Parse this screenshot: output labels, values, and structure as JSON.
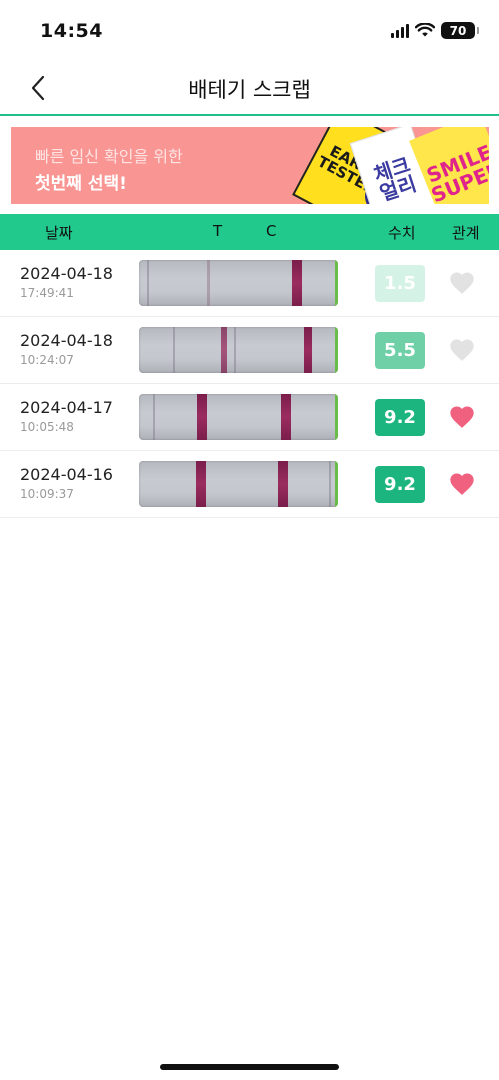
{
  "status_bar": {
    "time": "14:54",
    "battery": "70"
  },
  "nav": {
    "title": "배테기 스크랩"
  },
  "banner": {
    "line1": "빠른 임신 확인을 위한",
    "line2": "첫번째 선택!",
    "products": [
      "EARLY TESTER",
      "체크 얼리",
      "SMILE SUPER"
    ]
  },
  "table": {
    "headers": {
      "date": "날짜",
      "t": "T",
      "c": "C",
      "value": "수치",
      "relation": "관계"
    },
    "rows": [
      {
        "date": "2024-04-18",
        "time": "17:49:41",
        "value": "1.5",
        "value_color": "#d4f2e6",
        "heart": "empty"
      },
      {
        "date": "2024-04-18",
        "time": "10:24:07",
        "value": "5.5",
        "value_color": "#6fd0a8",
        "heart": "empty"
      },
      {
        "date": "2024-04-17",
        "time": "10:05:48",
        "value": "9.2",
        "value_color": "#1db57f",
        "heart": "filled"
      },
      {
        "date": "2024-04-16",
        "time": "10:09:37",
        "value": "9.2",
        "value_color": "#1db57f",
        "heart": "filled"
      }
    ]
  },
  "colors": {
    "accent": "#22c98c",
    "heart_filled": "#f0607f",
    "heart_empty": "#e2e2e2"
  }
}
